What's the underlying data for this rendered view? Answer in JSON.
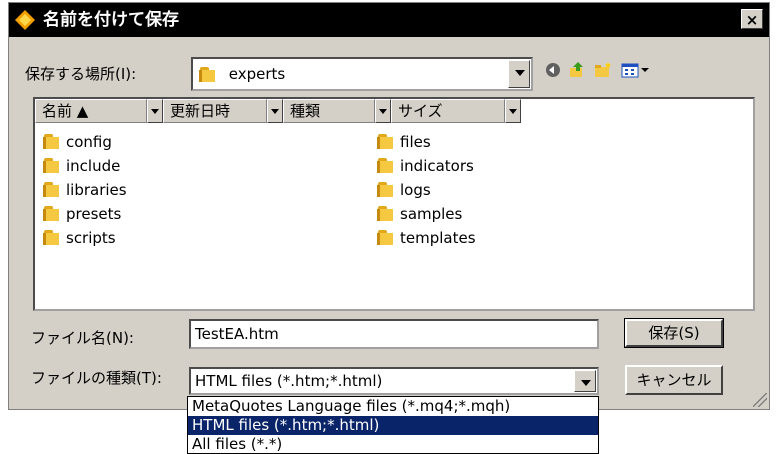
{
  "dialog": {
    "title": "名前を付けて保存",
    "close_label": "×"
  },
  "location": {
    "label": "保存する場所(I):",
    "value": "experts"
  },
  "toolbar": {
    "icons": [
      "back-icon",
      "up-folder-icon",
      "new-folder-icon",
      "view-menu-icon"
    ]
  },
  "columns": [
    {
      "label": "名前 ▲"
    },
    {
      "label": "更新日時"
    },
    {
      "label": "種類"
    },
    {
      "label": "サイズ"
    }
  ],
  "files_left": [
    "config",
    "include",
    "libraries",
    "presets",
    "scripts"
  ],
  "files_right": [
    "files",
    "indicators",
    "logs",
    "samples",
    "templates"
  ],
  "filename": {
    "label": "ファイル名(N):",
    "value": "TestEA.htm"
  },
  "filetype": {
    "label": "ファイルの種類(T):",
    "value": "HTML files (*.htm;*.html)",
    "options": [
      "MetaQuotes Language files (*.mq4;*.mqh)",
      "HTML files (*.htm;*.html)",
      "All files (*.*)"
    ]
  },
  "buttons": {
    "save": "保存(S)",
    "cancel": "キャンセル"
  },
  "colors": {
    "dialog_bg": "#d4d0c8",
    "titlebar_bg": "#000000",
    "selection": "#0a246a",
    "folder": "#f5c842"
  }
}
